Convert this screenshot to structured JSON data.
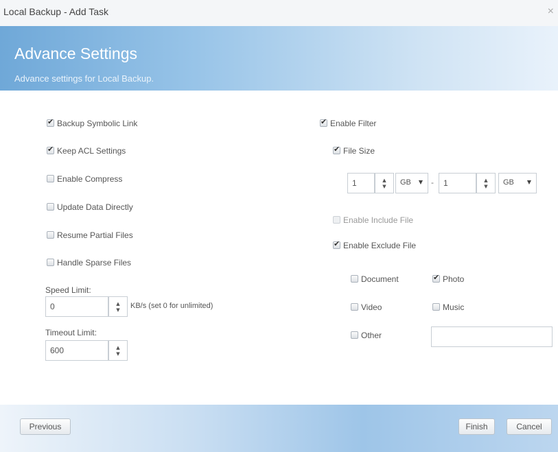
{
  "window": {
    "title": "Local Backup - Add Task",
    "close_glyph": "×"
  },
  "header": {
    "title": "Advance Settings",
    "subtitle": "Advance settings for Local Backup."
  },
  "left_options": [
    {
      "label": "Backup Symbolic Link",
      "checked": true
    },
    {
      "label": "Keep ACL Settings",
      "checked": true
    },
    {
      "label": "Enable Compress",
      "checked": false
    },
    {
      "label": "Update Data Directly",
      "checked": false
    },
    {
      "label": "Resume Partial Files",
      "checked": false
    },
    {
      "label": "Handle Sparse Files",
      "checked": false
    }
  ],
  "speed_limit": {
    "label": "Speed Limit:",
    "value": "0",
    "hint": "KB/s (set 0 for unlimited)"
  },
  "timeout_limit": {
    "label": "Timeout Limit:",
    "value": "600"
  },
  "filter": {
    "enable_label": "Enable Filter",
    "enable_checked": true,
    "file_size": {
      "label": "File Size",
      "checked": true,
      "min_value": "1",
      "min_unit": "GB",
      "separator": "-",
      "max_value": "1",
      "max_unit": "GB"
    },
    "include": {
      "label": "Enable Include File",
      "checked": false,
      "disabled": true
    },
    "exclude": {
      "label": "Enable Exclude File",
      "checked": true
    },
    "types": [
      {
        "label": "Document",
        "checked": false
      },
      {
        "label": "Photo",
        "checked": true
      },
      {
        "label": "Video",
        "checked": false
      },
      {
        "label": "Music",
        "checked": false
      },
      {
        "label": "Other",
        "checked": false
      }
    ],
    "other_value": ""
  },
  "buttons": {
    "previous": "Previous",
    "finish": "Finish",
    "cancel": "Cancel"
  },
  "icons": {
    "checkbox_checked": "check-icon",
    "spinner": "spinner-arrows-icon",
    "dropdown": "caret-down-icon"
  }
}
